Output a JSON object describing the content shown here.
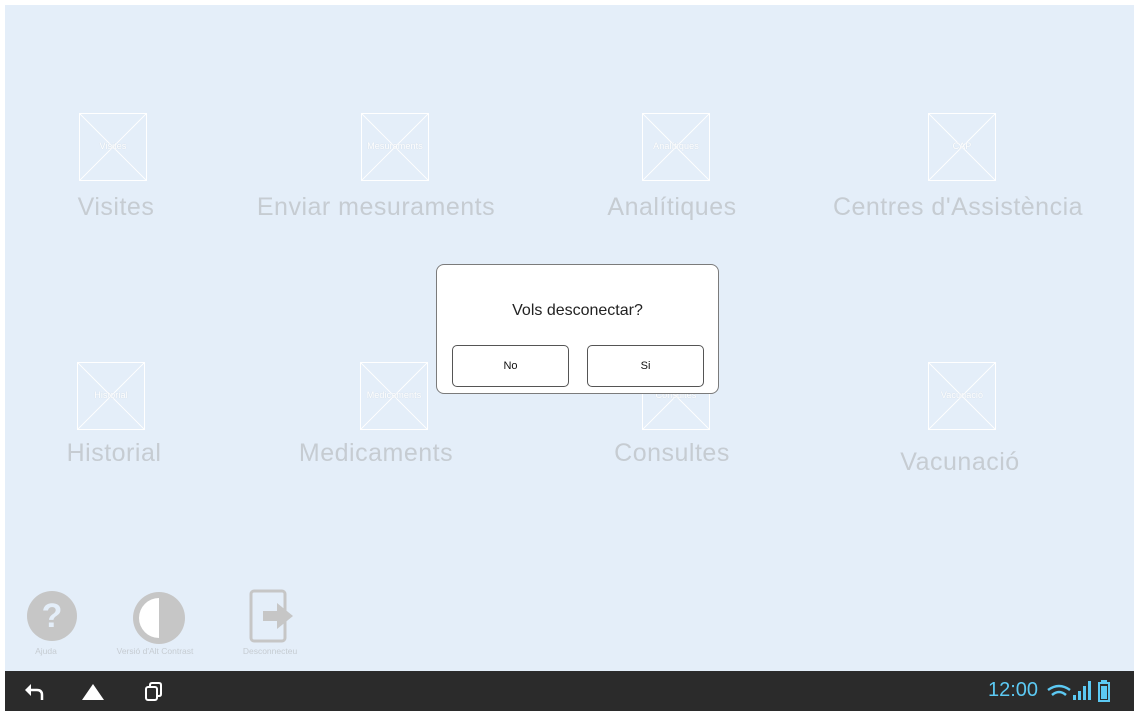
{
  "tiles_row1": [
    {
      "icon_text": "Visites",
      "label": "Visites"
    },
    {
      "icon_text": "Mesuraments",
      "label": "Enviar mesuraments"
    },
    {
      "icon_text": "Analítiques",
      "label": "Analítiques"
    },
    {
      "icon_text": "CAP",
      "label": "Centres d'Assistència"
    }
  ],
  "tiles_row2": [
    {
      "icon_text": "Historial",
      "label": "Historial"
    },
    {
      "icon_text": "Medicaments",
      "label": "Medicaments"
    },
    {
      "icon_text": "Consultes",
      "label": "Consultes"
    },
    {
      "icon_text": "Vacunació",
      "label": "Vacunació"
    }
  ],
  "tools": {
    "help_label": "Ajuda",
    "contrast_label": "Versió d'Alt Contrast",
    "disconnect_label": "Desconnecteu"
  },
  "dialog": {
    "title": "Vols desconectar?",
    "no_label": "No",
    "yes_label": "Si"
  },
  "statusbar": {
    "time": "12:00",
    "accent": "#5cc9f3"
  },
  "icons": {
    "back": "back-icon",
    "home": "home-icon",
    "recent": "recent-apps-icon",
    "wifi": "wifi-icon",
    "signal": "signal-icon",
    "battery": "battery-icon"
  }
}
